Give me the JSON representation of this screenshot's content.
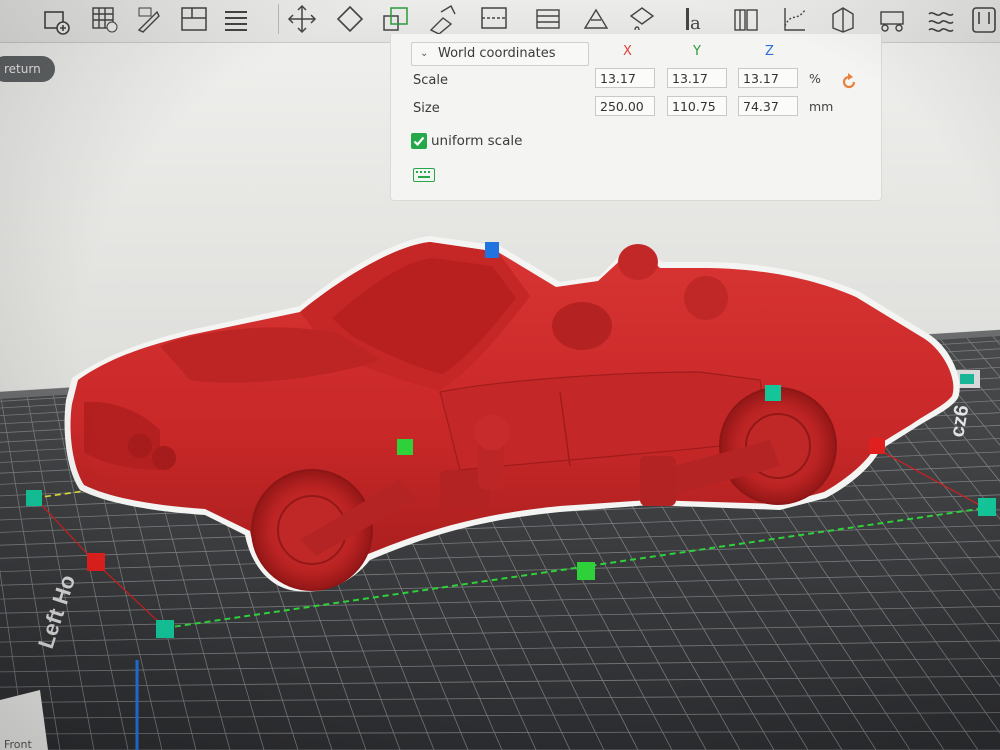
{
  "toolbar": {
    "icons": [
      "add-object-icon",
      "arrange-grid-icon",
      "auto-orient-icon",
      "layout-icon",
      "layers-list-icon",
      "move-icon",
      "rotate-icon",
      "scale-icon",
      "place-on-face-icon",
      "cut-icon",
      "support-paint-icon",
      "seam-paint-icon",
      "color-paint-icon",
      "text-icon",
      "assembly-icon",
      "measure-icon",
      "split-icon",
      "variable-height-icon",
      "brim-ears-icon",
      "extra-tool-icon"
    ]
  },
  "return_button": "return",
  "panel": {
    "coordinate_mode": "World coordinates",
    "axes": [
      "X",
      "Y",
      "Z"
    ],
    "axis_colors": [
      "#e04040",
      "#2a9a3a",
      "#2f6ed8"
    ],
    "scale": {
      "label": "Scale",
      "x": "13.17",
      "y": "13.17",
      "z": "13.17",
      "unit": "%"
    },
    "size": {
      "label": "Size",
      "x": "250.00",
      "y": "110.75",
      "z": "74.37",
      "unit": "mm"
    },
    "uniform_scale": {
      "label": "uniform scale",
      "checked": true
    },
    "reset_color": "#e8813a",
    "accent": "#25a84a"
  },
  "plate": {
    "left_label": "Left Ho",
    "front_label": "Front",
    "right_label": "cz6"
  },
  "model": {
    "color": "#cf2a2a",
    "outline": "#f2f2f2"
  },
  "gizmo_colors": {
    "x": "#e0201e",
    "y": "#2fd13b",
    "z": "#1f74e0",
    "corner": "#14c59a"
  }
}
